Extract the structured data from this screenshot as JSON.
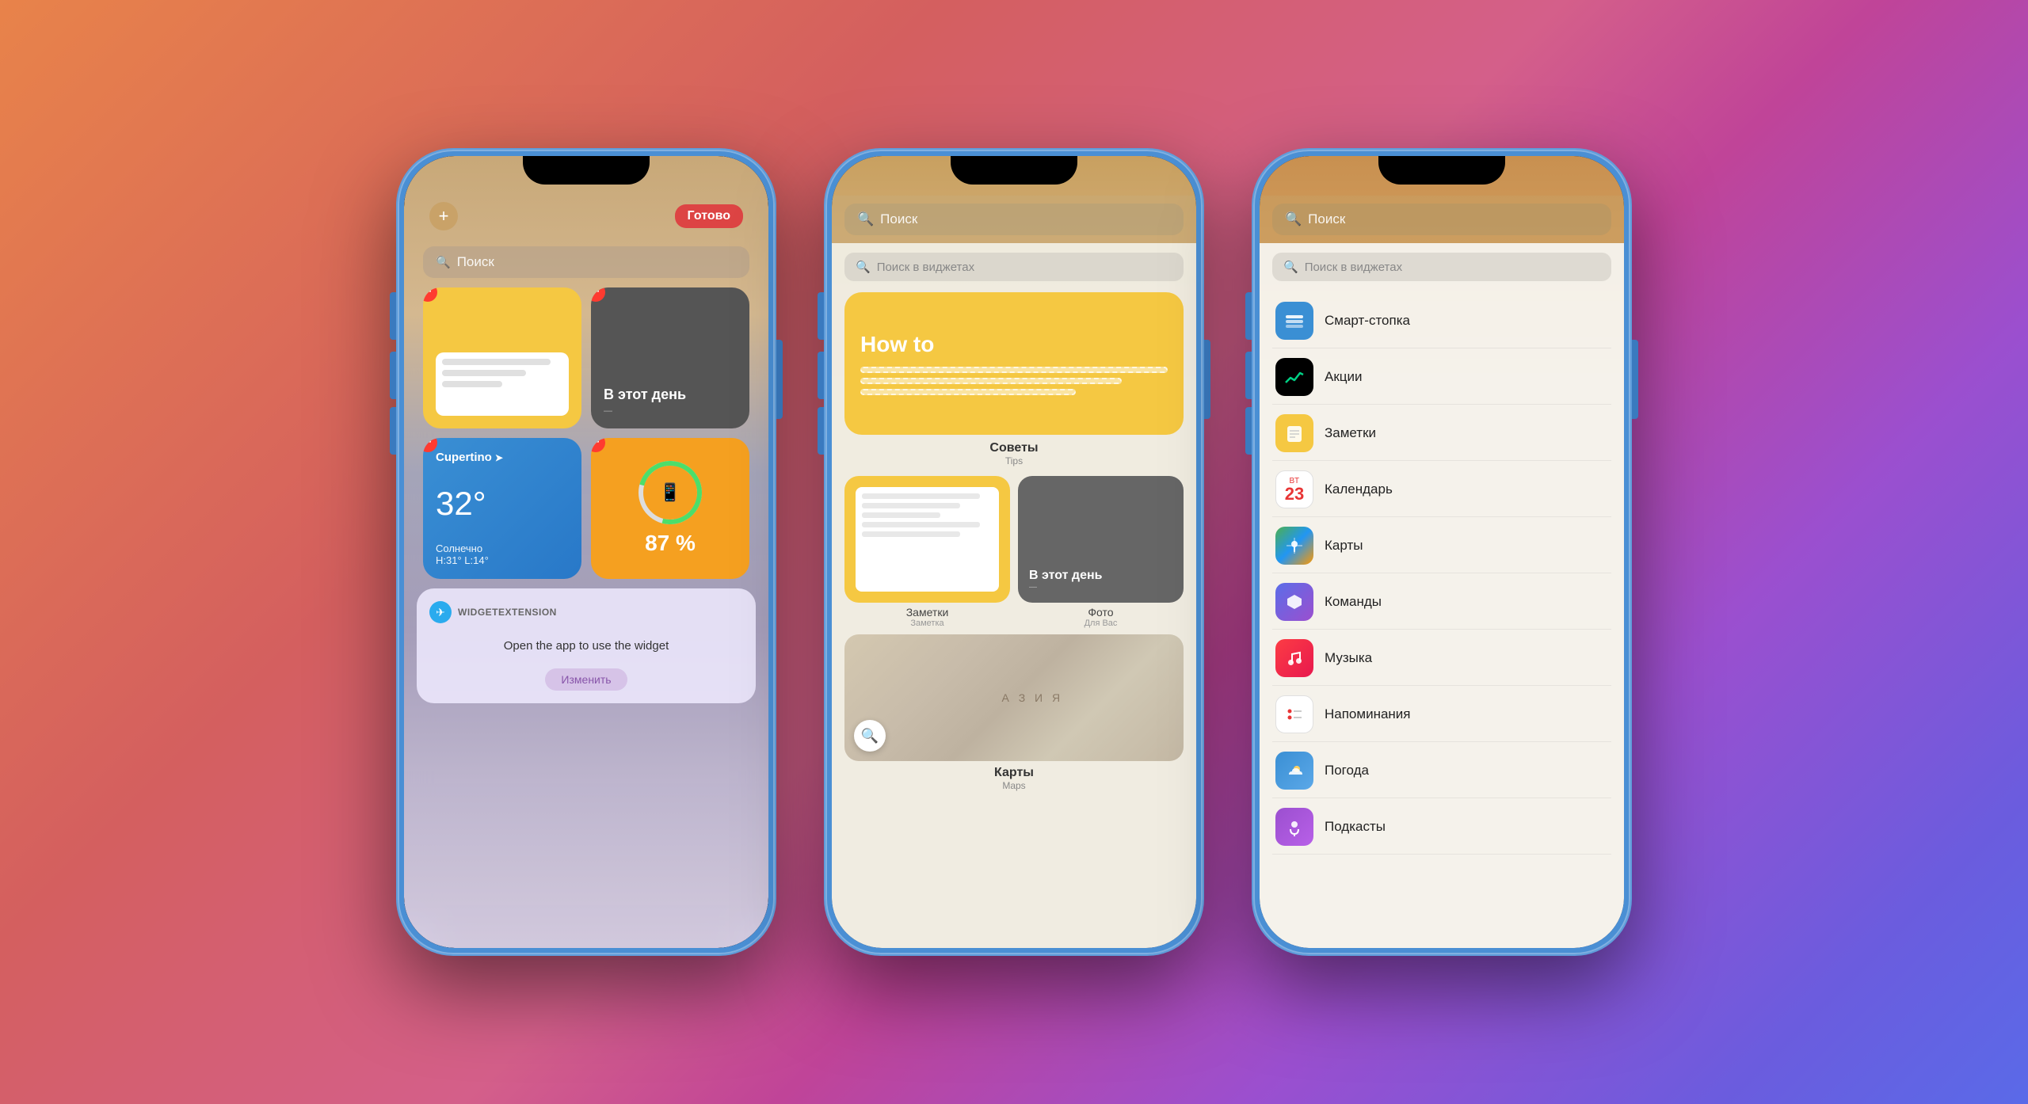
{
  "background": "gradient",
  "phones": [
    {
      "id": "phone1",
      "type": "widget-edit",
      "topBar": {
        "addLabel": "+",
        "doneLabel": "Готово"
      },
      "searchBar": {
        "icon": "🔍",
        "placeholder": "Поиск"
      },
      "widgets": [
        {
          "type": "notes",
          "label": ""
        },
        {
          "type": "onthisday",
          "label": "В этот день"
        },
        {
          "type": "weather",
          "city": "Cupertino",
          "temp": "32°",
          "desc": "Солнечно",
          "hiLo": "H:31° L:14°"
        },
        {
          "type": "battery",
          "percent": "87 %"
        }
      ],
      "telegramWidget": {
        "label": "WIDGETEXTENSION",
        "message": "Open the app to use the widget",
        "changeBtn": "Изменить"
      }
    },
    {
      "id": "phone2",
      "type": "widget-gallery",
      "searchBar": {
        "icon": "🔍",
        "placeholder": "Поиск"
      },
      "gallerySearch": {
        "icon": "🔍",
        "placeholder": "Поиск в виджетах"
      },
      "featuredWidget": {
        "howTo": "How to",
        "appLabel": "Советы",
        "appSub": "Tips"
      },
      "smallWidgets": [
        {
          "label": "Заметки",
          "sub": "Заметка"
        },
        {
          "label": "Фото",
          "sub": "Для Вас"
        }
      ],
      "mapWidget": {
        "label": "Карты",
        "sub": "Maps",
        "asiaText": "А З И Я"
      }
    },
    {
      "id": "phone3",
      "type": "app-list",
      "searchBar": {
        "icon": "🔍",
        "placeholder": "Поиск"
      },
      "listSearch": {
        "icon": "🔍",
        "placeholder": "Поиск в виджетах"
      },
      "apps": [
        {
          "name": "Смарт-стопка",
          "icon": "smartstack",
          "iconChar": "⊞"
        },
        {
          "name": "Акции",
          "icon": "stocks",
          "iconChar": "📈"
        },
        {
          "name": "Заметки",
          "icon": "notes",
          "iconChar": "📝"
        },
        {
          "name": "Календарь",
          "icon": "calendar",
          "date": "23",
          "month": "ВТ"
        },
        {
          "name": "Карты",
          "icon": "maps",
          "iconChar": "🗺"
        },
        {
          "name": "Команды",
          "icon": "shortcuts",
          "iconChar": "⬡"
        },
        {
          "name": "Музыка",
          "icon": "music",
          "iconChar": "♪"
        },
        {
          "name": "Напоминания",
          "icon": "reminders",
          "iconChar": "☑"
        },
        {
          "name": "Погода",
          "icon": "weather",
          "iconChar": "🌤"
        },
        {
          "name": "Подкасты",
          "icon": "podcasts",
          "iconChar": "🎙"
        }
      ]
    }
  ]
}
